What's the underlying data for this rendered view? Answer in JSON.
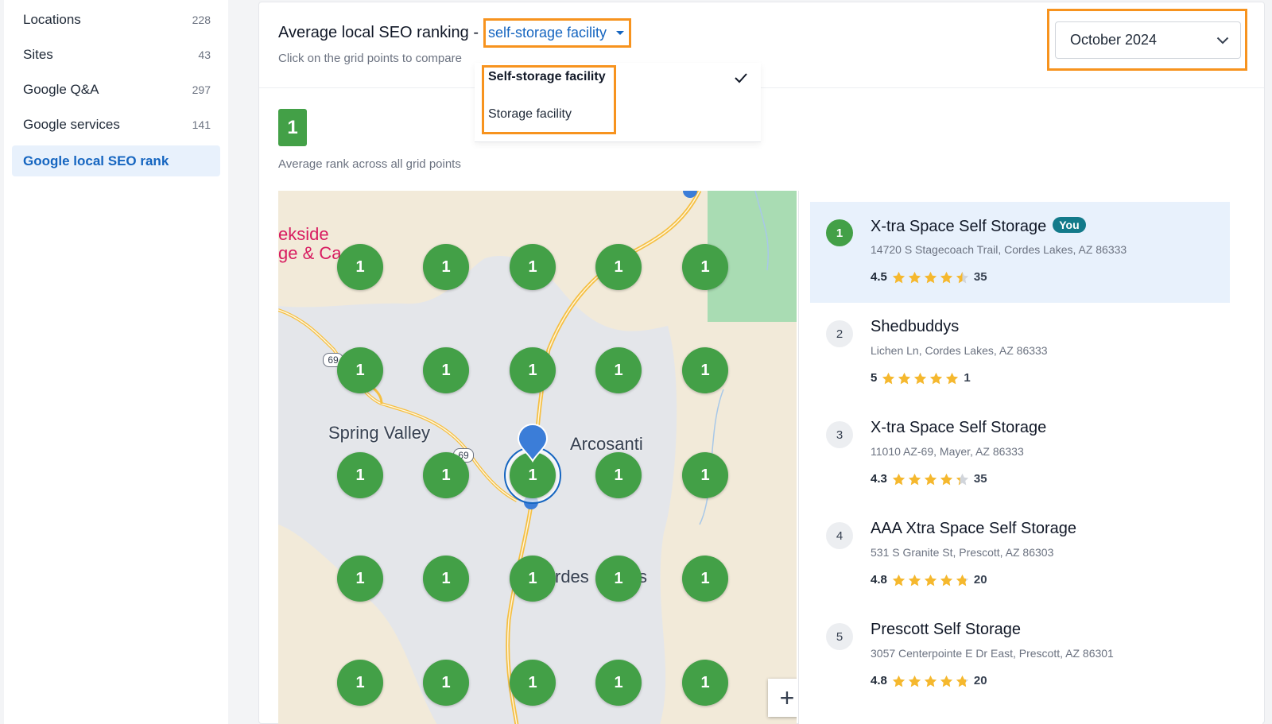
{
  "sidebar": {
    "items": [
      {
        "label": "Locations",
        "count": "228"
      },
      {
        "label": "Sites",
        "count": "43"
      },
      {
        "label": "Google Q&A",
        "count": "297"
      },
      {
        "label": "Google services",
        "count": "141"
      },
      {
        "label": "Google local SEO rank",
        "count": ""
      }
    ],
    "active_index": 4
  },
  "header": {
    "title": "Average local SEO ranking -",
    "keyword": "self-storage facility",
    "subtitle": "Click on the grid points to compare"
  },
  "keyword_menu": {
    "options": [
      "Self-storage facility",
      "Storage facility"
    ],
    "selected": "Self-storage facility"
  },
  "date_select": {
    "value": "October 2024"
  },
  "summary": {
    "rank": "1",
    "caption": "Average rank across all grid points"
  },
  "map": {
    "labels": {
      "place_1": "Spring Valley",
      "place_2": "Arcosanti",
      "place_3": "rdes",
      "place_4": "s",
      "corner_1": "ekside",
      "corner_2": "ge & Ca",
      "shield_1": "69",
      "shield_2": "69"
    },
    "grid_ranks": [
      [
        "1",
        "1",
        "1",
        "1",
        "1"
      ],
      [
        "1",
        "1",
        "1",
        "1",
        "1"
      ],
      [
        "1",
        "1",
        "1",
        "1",
        "1"
      ],
      [
        "1",
        "1",
        "1",
        "1",
        "1"
      ],
      [
        "1",
        "1",
        "1",
        "1",
        "1"
      ]
    ],
    "zoom_in_label": "+"
  },
  "results": [
    {
      "rank": "1",
      "name": "X-tra Space Self Storage",
      "badge": "You",
      "address": "14720 S Stagecoach Trail, Cordes Lakes, AZ 86333",
      "rating": "4.5",
      "stars": 4.5,
      "reviews": "35"
    },
    {
      "rank": "2",
      "name": "Shedbuddys",
      "badge": "",
      "address": "Lichen Ln, Cordes Lakes, AZ 86333",
      "rating": "5",
      "stars": 5,
      "reviews": "1"
    },
    {
      "rank": "3",
      "name": "X-tra Space Self Storage",
      "badge": "",
      "address": "11010 AZ-69, Mayer, AZ 86333",
      "rating": "4.3",
      "stars": 4.3,
      "reviews": "35"
    },
    {
      "rank": "4",
      "name": "AAA Xtra Space Self Storage",
      "badge": "",
      "address": "531 S Granite St, Prescott, AZ 86303",
      "rating": "4.8",
      "stars": 4.8,
      "reviews": "20"
    },
    {
      "rank": "5",
      "name": "Prescott Self Storage",
      "badge": "",
      "address": "3057 Centerpointe E Dr East, Prescott, AZ 86301",
      "rating": "4.8",
      "stars": 4.8,
      "reviews": "20"
    }
  ],
  "colors": {
    "accent": "#1565c0",
    "rank_green": "#43a047",
    "highlight": "#f7931e",
    "star": "#f5b82e"
  }
}
